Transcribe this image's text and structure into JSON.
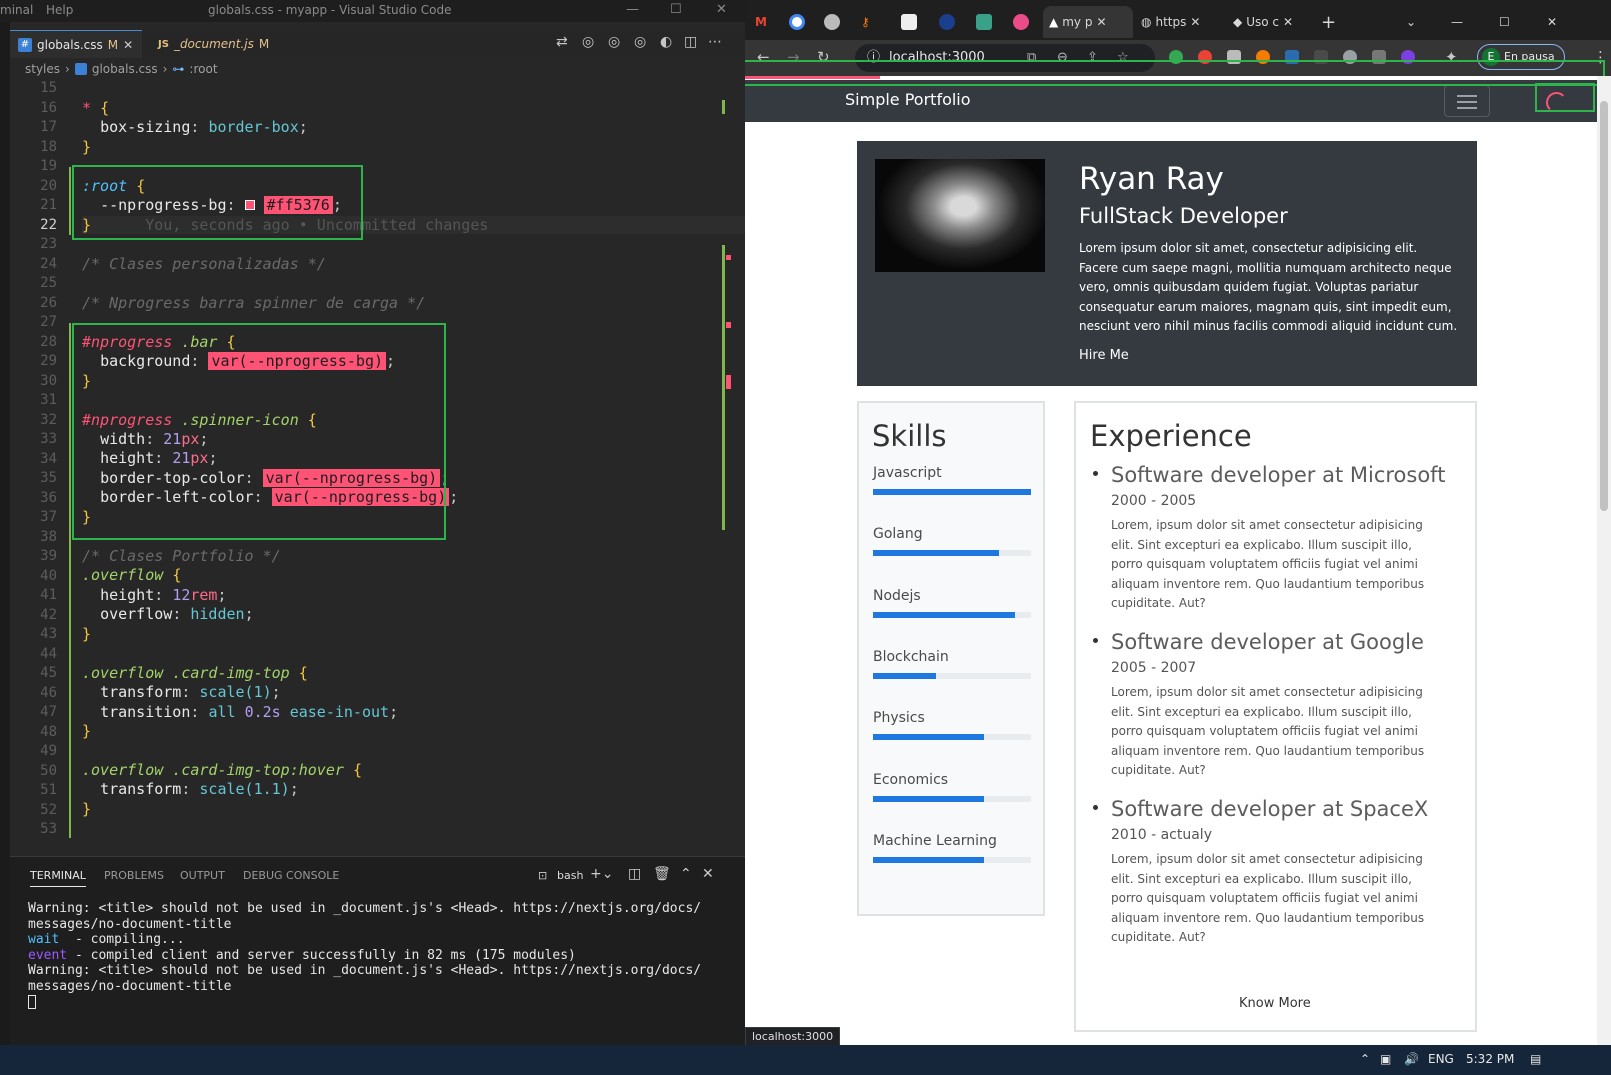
{
  "vscode": {
    "menu": [
      "minal",
      "Help"
    ],
    "title": "globals.css - myapp - Visual Studio Code",
    "tabs": [
      {
        "badge": "CSS",
        "label": "globals.css",
        "mod": "M"
      },
      {
        "badge": "JS",
        "label": "_document.js",
        "mod": "M"
      }
    ],
    "breadcrumb": [
      "styles",
      "globals.css",
      ":root"
    ],
    "line_numbers": [
      "15",
      "16",
      "17",
      "18",
      "19",
      "20",
      "21",
      "22",
      "23",
      "24",
      "25",
      "26",
      "27",
      "28",
      "29",
      "30",
      "31",
      "32",
      "33",
      "34",
      "35",
      "36",
      "37",
      "38",
      "39",
      "40",
      "41",
      "42",
      "43",
      "44",
      "45",
      "46",
      "47",
      "48",
      "49",
      "50",
      "51",
      "52",
      "53"
    ],
    "code": {
      "l16_sel": "*",
      "l17_prop": "box-sizing",
      "l17_val": "border-box",
      "l20_sel": ":root",
      "l21_prop": "--nprogress-bg",
      "l21_val": "#ff5376",
      "blame": "You, seconds ago • Uncommitted changes",
      "l24": "/* Clases personalizadas */",
      "l26": "/* Nprogress barra spinner de carga */",
      "l28_id": "#nprogress",
      "l28_cls": ".bar",
      "l29_prop": "background",
      "l29_val": "var(--nprogress-bg)",
      "l32_id": "#nprogress",
      "l32_cls": ".spinner-icon",
      "l33_prop": "width",
      "l33_num": "21",
      "l33_unit": "px",
      "l34_prop": "height",
      "l34_num": "21",
      "l34_unit": "px",
      "l35_prop": "border-top-color",
      "l35_val": "var(--nprogress-bg)",
      "l36_prop": "border-left-color",
      "l36_val": "var(--nprogress-bg)",
      "l39": "/* Clases Portfolio */",
      "l40_cls": ".overflow",
      "l41_prop": "height",
      "l41_num": "12",
      "l41_unit": "rem",
      "l42_prop": "overflow",
      "l42_val": "hidden",
      "l45_cls": ".overflow .card-img-top",
      "l46_prop": "transform",
      "l46_val": "scale(1)",
      "l47_prop": "transition",
      "l47_a": "all",
      "l47_b": "0.2s",
      "l47_c": "ease-in-out",
      "l50_cls": ".overflow .card-img-top:hover",
      "l51_prop": "transform",
      "l51_val": "scale(1.1)"
    },
    "panel_tabs": [
      "TERMINAL",
      "PROBLEMS",
      "OUTPUT",
      "DEBUG CONSOLE"
    ],
    "shell": "bash",
    "terminal": [
      "Warning: <title> should not be used in _document.js's <Head>. https://nextjs.org/docs/",
      "messages/no-document-title",
      "wait  - compiling...",
      "event - compiled client and server successfully in 82 ms (175 modules)",
      "Warning: <title> should not be used in _document.js's <Head>. https://nextjs.org/docs/",
      "messages/no-document-title"
    ],
    "term_wait": "wait",
    "term_wait_rest": "  - compiling...",
    "term_event": "event",
    "term_event_rest": " - compiled client and server successfully in 82 ms (175 modules)"
  },
  "chrome": {
    "tabs": [
      "my p",
      "https",
      "Uso c"
    ],
    "url": "localhost:3000",
    "profile": "En pausa",
    "profile_initial": "E"
  },
  "site": {
    "brand": "Simple Portfolio",
    "name": "Ryan Ray",
    "role": "FullStack Developer",
    "bio": "Lorem ipsum dolor sit amet, consectetur adipisicing elit. Facere cum saepe magni, mollitia numquam architecto neque vero, omnis quibusdam quidem fugiat. Voluptas pariatur consequatur earum maiores, magnam quis, sint impedit eum, nesciunt vero nihil minus facilis commodi aliquid incidunt cum.",
    "hire": "Hire Me",
    "skills_title": "Skills",
    "skills": [
      {
        "name": "Javascript",
        "level": 1.0
      },
      {
        "name": "Golang",
        "level": 0.8
      },
      {
        "name": "Nodejs",
        "level": 0.9
      },
      {
        "name": "Blockchain",
        "level": 0.4
      },
      {
        "name": "Physics",
        "level": 0.7
      },
      {
        "name": "Economics",
        "level": 0.7
      },
      {
        "name": "Machine Learning",
        "level": 0.7
      }
    ],
    "exp_title": "Experience",
    "jobs": [
      {
        "title": "Software developer at Microsoft",
        "dates": "2000 - 2005",
        "desc": "Lorem, ipsum dolor sit amet consectetur adipisicing elit. Sint excepturi ea explicabo. Illum suscipit illo, porro quisquam voluptatem officiis fugiat vel animi aliquam inventore rem. Quo laudantium temporibus cupiditate. Aut?"
      },
      {
        "title": "Software developer at Google",
        "dates": "2005 - 2007",
        "desc": "Lorem, ipsum dolor sit amet consectetur adipisicing elit. Sint excepturi ea explicabo. Illum suscipit illo, porro quisquam voluptatem officiis fugiat vel animi aliquam inventore rem. Quo laudantium temporibus cupiditate. Aut?"
      },
      {
        "title": "Software developer at SpaceX",
        "dates": "2010 - actualy",
        "desc": "Lorem, ipsum dolor sit amet consectetur adipisicing elit. Sint excepturi ea explicabo. Illum suscipit illo, porro quisquam voluptatem officiis fugiat vel animi aliquam inventore rem. Quo laudantium temporibus cupiditate. Aut?"
      }
    ],
    "know_more": "Know More",
    "status_url": "localhost:3000"
  },
  "taskbar": {
    "lang": "ENG",
    "time": "5:32 PM"
  },
  "colors": {
    "accent": "#ff5376",
    "highlight_box": "#2db44a",
    "skill_bar": "#1e78e0"
  }
}
